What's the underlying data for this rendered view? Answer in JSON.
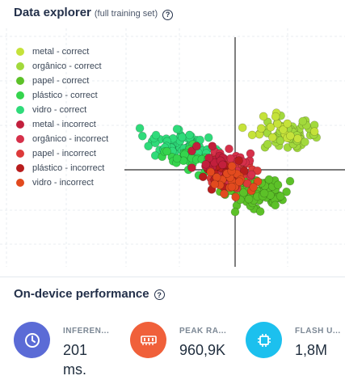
{
  "header": {
    "title": "Data explorer",
    "subtitle": "(full training set)",
    "help_icon": "question-circle-icon"
  },
  "legend": [
    {
      "label": "metal - correct",
      "color": "#c5e23a"
    },
    {
      "label": "orgânico - correct",
      "color": "#a2d93c"
    },
    {
      "label": "papel - correct",
      "color": "#5cc128"
    },
    {
      "label": "plástico - correct",
      "color": "#35d44d"
    },
    {
      "label": "vidro - correct",
      "color": "#2fdb7a"
    },
    {
      "label": "metal - incorrect",
      "color": "#c21f3c"
    },
    {
      "label": "orgânico - incorrect",
      "color": "#d6304a"
    },
    {
      "label": "papel - incorrect",
      "color": "#dd3a3a"
    },
    {
      "label": "plástico - incorrect",
      "color": "#b81d1d"
    },
    {
      "label": "vidro - incorrect",
      "color": "#e24a1e"
    }
  ],
  "performance": {
    "title": "On-device performance",
    "help_icon": "question-circle-icon",
    "metrics": [
      {
        "label": "INFEREN...",
        "value": "201 ms.",
        "icon": "clock-icon",
        "color": "#5b6bd6"
      },
      {
        "label": "PEAK RA...",
        "value": "960,9K",
        "icon": "memory-chip-icon",
        "color": "#f0603a"
      },
      {
        "label": "FLASH U...",
        "value": "1,8M",
        "icon": "cpu-chip-icon",
        "color": "#1cc0ee"
      }
    ]
  }
}
